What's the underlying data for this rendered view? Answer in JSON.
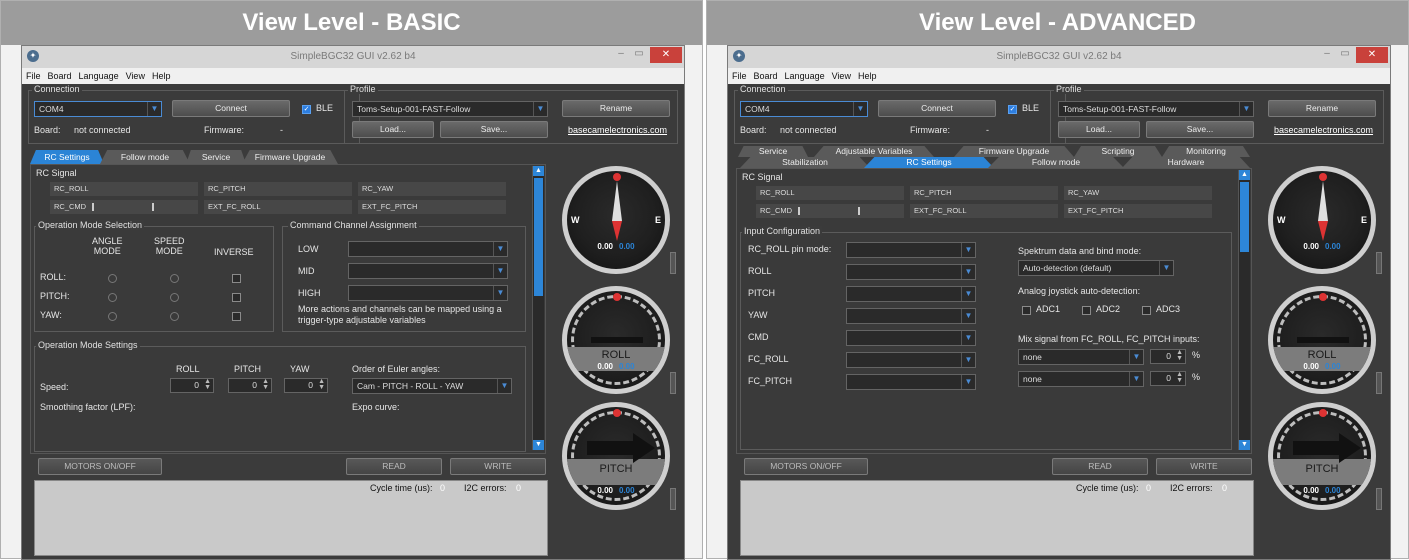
{
  "panels": {
    "basic": {
      "heading": "View Level - BASIC"
    },
    "advanced": {
      "heading": "View Level - ADVANCED"
    }
  },
  "window": {
    "title": "SimpleBGC32 GUI v2.62 b4",
    "close": "✕",
    "min": "–",
    "max": "▭"
  },
  "menu": [
    "File",
    "Board",
    "Language",
    "View",
    "Help"
  ],
  "connection": {
    "group": "Connection",
    "port": "COM4",
    "connect": "Connect",
    "ble": "BLE",
    "board_label": "Board:",
    "board_value": "not connected",
    "firmware_label": "Firmware:",
    "firmware_value": "-"
  },
  "profile": {
    "group": "Profile",
    "name": "Toms-Setup-001-FAST-Follow",
    "rename": "Rename",
    "load": "Load...",
    "save": "Save...",
    "link": "basecamelectronics.com"
  },
  "basic": {
    "tabs": [
      "RC Settings",
      "Follow mode",
      "Service",
      "Firmware Upgrade"
    ],
    "rc_signal": "RC Signal",
    "rc_cells": [
      "RC_ROLL",
      "RC_PITCH",
      "RC_YAW",
      "RC_CMD",
      "EXT_FC_ROLL",
      "EXT_FC_PITCH"
    ],
    "op_mode": {
      "group": "Operation Mode Selection",
      "col1": "ANGLE\nMODE",
      "col2": "SPEED\nMODE",
      "col3": "INVERSE",
      "rows": [
        "ROLL:",
        "PITCH:",
        "YAW:"
      ]
    },
    "cmd_channel": {
      "group": "Command Channel Assignment",
      "rows": [
        "LOW",
        "MID",
        "HIGH"
      ],
      "note": "More actions and channels can be mapped using a trigger-type adjustable variables"
    },
    "op_settings": {
      "group": "Operation Mode Settings",
      "cols": [
        "ROLL",
        "PITCH",
        "YAW"
      ],
      "speed": "Speed:",
      "smoothing": "Smoothing factor (LPF):",
      "speed_vals": [
        "0",
        "0",
        "0"
      ],
      "euler_label": "Order of Euler angles:",
      "euler_value": "Cam - PITCH - ROLL - YAW",
      "expo": "Expo curve:"
    }
  },
  "advanced": {
    "tabs_top": [
      "Service",
      "Adjustable Variables",
      "Firmware Upgrade",
      "Scripting",
      "Monitoring"
    ],
    "tabs_bottom": [
      "Stabilization",
      "RC Settings",
      "Follow mode",
      "Hardware"
    ],
    "rc_signal": "RC Signal",
    "rc_cells": [
      "RC_ROLL",
      "RC_PITCH",
      "RC_YAW",
      "RC_CMD",
      "EXT_FC_ROLL",
      "EXT_FC_PITCH"
    ],
    "input_cfg": {
      "group": "Input Configuration",
      "rows": [
        "RC_ROLL pin mode:",
        "ROLL",
        "PITCH",
        "YAW",
        "CMD",
        "FC_ROLL",
        "FC_PITCH"
      ]
    },
    "spektrum_label": "Spektrum data and bind mode:",
    "spektrum_value": "Auto-detection (default)",
    "analog_label": "Analog joystick auto-detection:",
    "adc": [
      "ADC1",
      "ADC2",
      "ADC3"
    ],
    "mix_label": "Mix signal from FC_ROLL, FC_PITCH inputs:",
    "mix_rows": [
      {
        "value": "none",
        "num": "0",
        "unit": "%"
      },
      {
        "value": "none",
        "num": "0",
        "unit": "%"
      }
    ]
  },
  "bottom": {
    "motors": "MOTORS ON/OFF",
    "read": "READ",
    "write": "WRITE",
    "cycle_label": "Cycle time (us):",
    "cycle_value": "0",
    "i2c_label": "I2C errors:",
    "i2c_value": "0"
  },
  "gauges": {
    "compass": {
      "west": "W",
      "east": "E",
      "val1": "0.00",
      "val2": "0.00"
    },
    "roll": {
      "label": "ROLL",
      "val1": "0.00",
      "val2": "0.00"
    },
    "pitch": {
      "label": "PITCH",
      "val1": "0.00",
      "val2": "0.00"
    }
  },
  "colors": {
    "accent": "#2b84d6",
    "close": "#c9413b",
    "bg": "#3b3b3b"
  }
}
